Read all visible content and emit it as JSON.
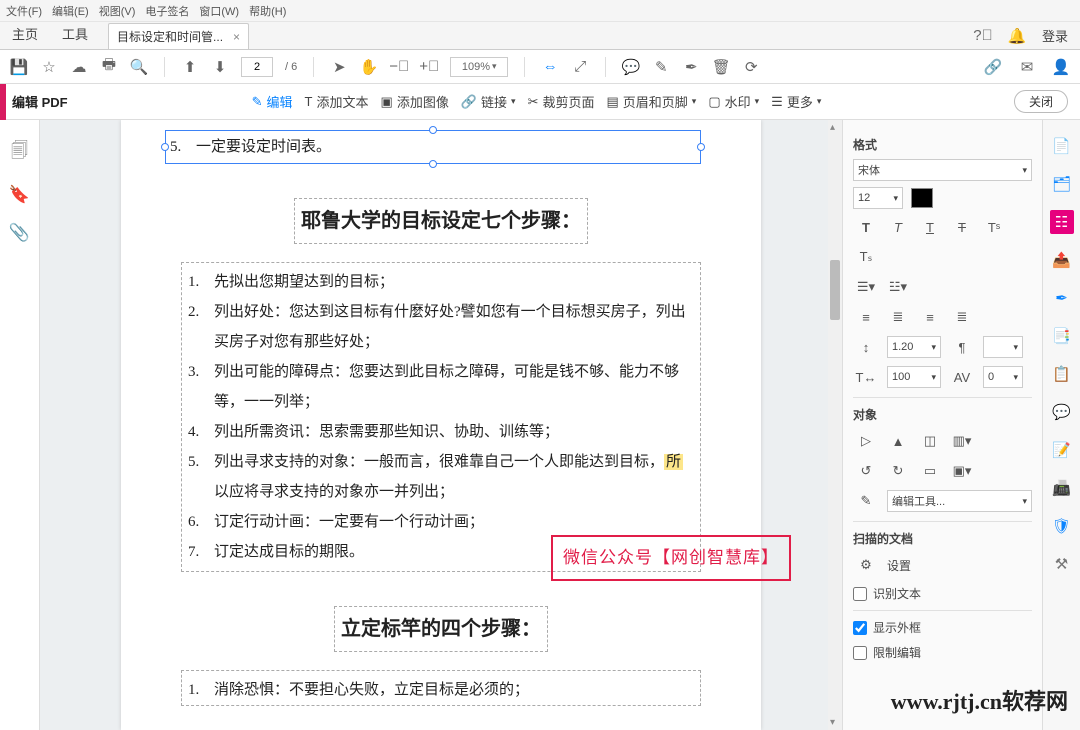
{
  "menubar": {
    "file": "文件(F)",
    "edit": "编辑(E)",
    "view": "视图(V)",
    "esign": "电子签名",
    "window": "窗口(W)",
    "help": "帮助(H)"
  },
  "tabs": {
    "home": "主页",
    "tools": "工具",
    "doc": "目标设定和时间管...",
    "login": "登录"
  },
  "toolbar1": {
    "page_current": "2",
    "page_total": "/ 6",
    "zoom": "109%"
  },
  "toolbar2": {
    "label": "编辑 PDF",
    "edit": "编辑",
    "add_text": "添加文本",
    "add_image": "添加图像",
    "link": "链接",
    "crop": "裁剪页面",
    "headerfooter": "页眉和页脚",
    "watermark": "水印",
    "more": "更多",
    "close": "关闭"
  },
  "doc": {
    "item5_top": "一定要设定时间表。",
    "heading1": "耶鲁大学的目标设定七个步骤：",
    "list1": [
      "先拟出您期望达到的目标；",
      "列出好处：您达到这目标有什麼好处?譬如您有一个目标想买房子，列出买房子对您有那些好处；",
      "列出可能的障碍点：您要达到此目标之障碍，可能是钱不够、能力不够等，一一列举；",
      "列出所需资讯：思索需要那些知识、协助、训练等；",
      "列出寻求支持的对象：一般而言，很难靠自己一个人即能达到目标，",
      "订定行动计画：一定要有一个行动计画；",
      "订定达成目标的期限。"
    ],
    "item5_suffix_hl": "所",
    "item5_suffix_rest": "以应将寻求支持的对象亦一并列出；",
    "heading2": "立定标竿的四个步骤：",
    "list2_item1": "消除恐惧：不要担心失败，立定目标是必须的；",
    "red_stamp": "微信公众号【网创智慧库】"
  },
  "right_panel": {
    "section_format": "格式",
    "font_family": "宋体",
    "font_size": "12",
    "line_spacing": "1.20",
    "char_scale": "100",
    "char_spacing": "0",
    "section_object": "对象",
    "edit_tools": "编辑工具...",
    "section_scan": "扫描的文档",
    "settings": "设置",
    "recognize_text": "识别文本",
    "show_outline": "显示外框",
    "restrict_edit": "限制编辑"
  },
  "watermark": "www.rjtj.cn软荐网"
}
